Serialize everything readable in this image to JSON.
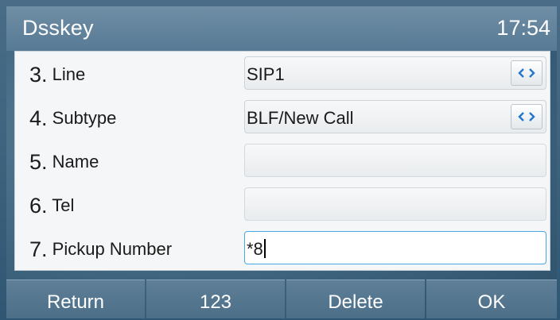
{
  "titlebar": {
    "title": "Dsskey",
    "clock": "17:54"
  },
  "rows": [
    {
      "num": "3.",
      "label": "Line",
      "value": "SIP1",
      "has_arrows": true
    },
    {
      "num": "4.",
      "label": "Subtype",
      "value": "BLF/New Call",
      "has_arrows": true
    },
    {
      "num": "5.",
      "label": "Name",
      "value": "",
      "has_arrows": false
    },
    {
      "num": "6.",
      "label": "Tel",
      "value": "",
      "has_arrows": false
    },
    {
      "num": "7.",
      "label": "Pickup Number",
      "value": "*8",
      "has_arrows": false,
      "active": true
    }
  ],
  "softkeys": {
    "return": "Return",
    "input_mode": "123",
    "delete": "Delete",
    "ok": "OK"
  },
  "colors": {
    "accent": "#4aa7df",
    "arrow": "#2277cc"
  }
}
